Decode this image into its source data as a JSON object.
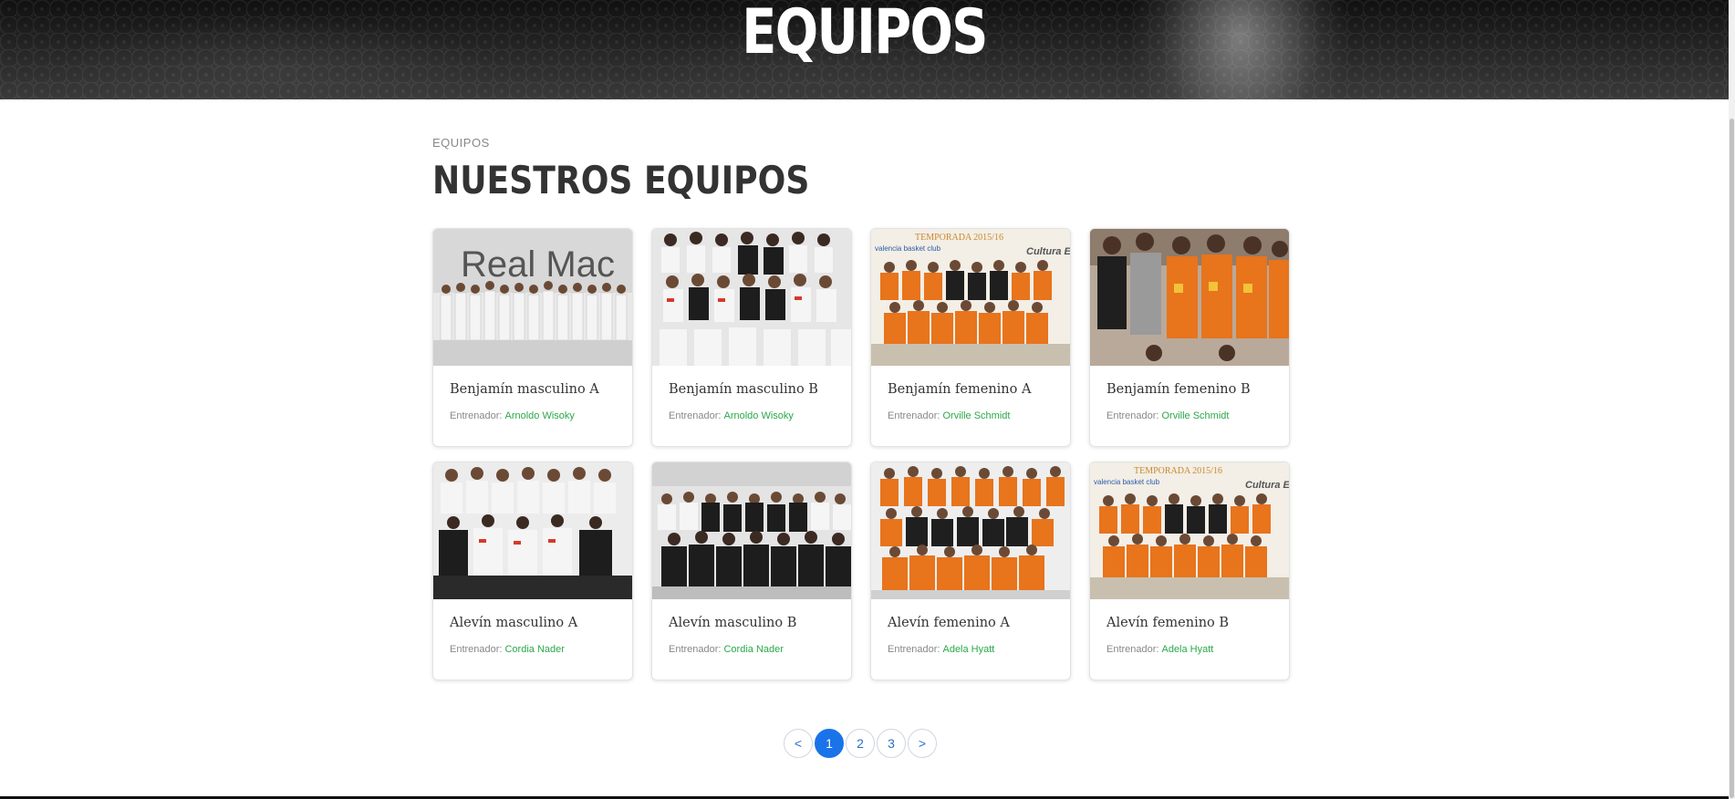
{
  "hero": {
    "title": "EQUIPOS"
  },
  "section": {
    "eyebrow": "EQUIPOS",
    "title": "NUESTROS EQUIPOS"
  },
  "teams": [
    {
      "name": "Benjamín masculino A",
      "coach_label": "Entrenador:",
      "coach": "Arnoldo Wisoky",
      "photo": "team-photo-white-kit"
    },
    {
      "name": "Benjamín masculino B",
      "coach_label": "Entrenador:",
      "coach": "Arnoldo Wisoky",
      "photo": "team-photo-white-kit"
    },
    {
      "name": "Benjamín femenino A",
      "coach_label": "Entrenador:",
      "coach": "Orville Schmidt",
      "photo": "team-photo-orange-kit"
    },
    {
      "name": "Benjamín femenino B",
      "coach_label": "Entrenador:",
      "coach": "Orville Schmidt",
      "photo": "team-photo-orange-kit"
    },
    {
      "name": "Alevín masculino A",
      "coach_label": "Entrenador:",
      "coach": "Cordia Nader",
      "photo": "team-photo-white-kit"
    },
    {
      "name": "Alevín masculino B",
      "coach_label": "Entrenador:",
      "coach": "Cordia Nader",
      "photo": "team-photo-white-kit"
    },
    {
      "name": "Alevín femenino A",
      "coach_label": "Entrenador:",
      "coach": "Adela Hyatt",
      "photo": "team-photo-orange-kit"
    },
    {
      "name": "Alevín femenino B",
      "coach_label": "Entrenador:",
      "coach": "Adela Hyatt",
      "photo": "team-photo-orange-kit"
    }
  ],
  "photo_text": {
    "banner_1": "Real Mac",
    "season": "TEMPORADA 2015/16",
    "club": "valencia basket club",
    "sponsor": "Cultura Esfuerz"
  },
  "pagination": {
    "prev": "<",
    "pages": [
      "1",
      "2",
      "3"
    ],
    "next": ">",
    "current": "1"
  },
  "colors": {
    "accent": "#1a73e8",
    "coach": "#2aa84a",
    "orange_kit": "#e8741c"
  }
}
